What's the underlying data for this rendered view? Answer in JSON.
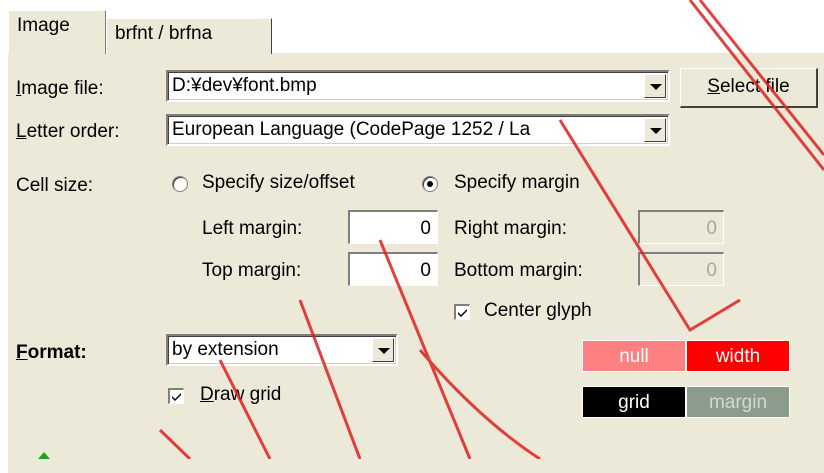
{
  "tabs": [
    {
      "label": "Image"
    },
    {
      "label": "brfnt / brfna"
    }
  ],
  "image_file": {
    "label_prefix": "I",
    "label_rest": "mage file:",
    "value": "D:¥dev¥font.bmp",
    "select_button_prefix": "S",
    "select_button_rest": "elect file"
  },
  "letter_order": {
    "label_prefix": "L",
    "label_rest": "etter order:",
    "value": "European Language (CodePage 1252 / La"
  },
  "cell_size": {
    "label": "Cell size:",
    "option_size_offset": "Specify size/offset",
    "option_margin": "Specify margin",
    "selected": "margin",
    "left_margin_label": "Left margin:",
    "left_margin_value": "0",
    "right_margin_label": "Right margin:",
    "right_margin_value": "0",
    "top_margin_label": "Top margin:",
    "top_margin_value": "0",
    "bottom_margin_label": "Bottom margin:",
    "bottom_margin_value": "0",
    "center_glyph_label": "Center glyph",
    "center_glyph_checked": true
  },
  "format": {
    "label_prefix": "F",
    "label_rest": "ormat:",
    "value": "by extension"
  },
  "draw_grid": {
    "label_prefix": "D",
    "label_rest": "raw grid",
    "checked": true
  },
  "color_swatches": [
    {
      "label": "null",
      "bg": "#ff8080",
      "fg": "#ffffff"
    },
    {
      "label": "width",
      "bg": "#ff0000",
      "fg": "#ffffff"
    },
    {
      "label": "grid",
      "bg": "#000000",
      "fg": "#ffffff"
    },
    {
      "label": "margin",
      "bg": "#8c9c8c",
      "fg": "#d4d8d4"
    }
  ],
  "colors": {
    "dialog_bg": "#ece9d8",
    "watermark": "#e02020"
  }
}
